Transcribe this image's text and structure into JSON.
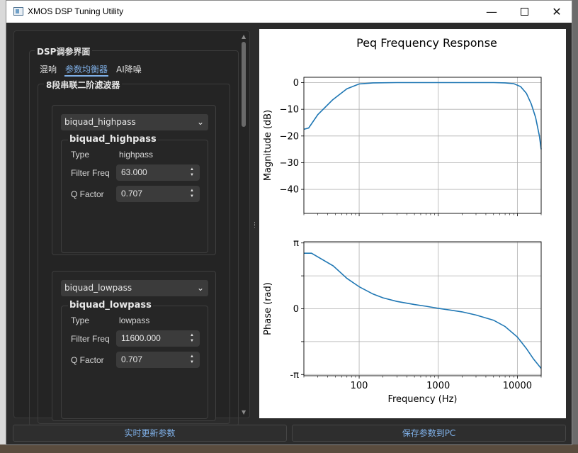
{
  "window": {
    "title": "XMOS DSP Tuning Utility",
    "minimize": "—",
    "close": "✕"
  },
  "settings": {
    "group_title": "DSP调参界面",
    "tabs": [
      {
        "label": "混响",
        "active": false
      },
      {
        "label": "参数均衡器",
        "active": true
      },
      {
        "label": "AI降噪",
        "active": false
      }
    ],
    "section_title": "8段串联二阶滤波器",
    "filters": [
      {
        "selected_type": "biquad_highpass",
        "group_title": "biquad_highpass",
        "type_label": "Type",
        "type_value": "highpass",
        "freq_label": "Filter Freq",
        "freq_value": "63.000",
        "q_label": "Q Factor",
        "q_value": "0.707"
      },
      {
        "selected_type": "biquad_lowpass",
        "group_title": "biquad_lowpass",
        "type_label": "Type",
        "type_value": "lowpass",
        "freq_label": "Filter Freq",
        "freq_value": "11600.000",
        "q_label": "Q Factor",
        "q_value": "0.707"
      }
    ]
  },
  "buttons": {
    "realtime": "实时更新参数",
    "save": "保存参数到PC"
  },
  "colors": {
    "accent": "#7fb0e8",
    "curve": "#1f77b4",
    "panel_bg": "#242424"
  },
  "icons": {
    "dropdown": "chevron-down-icon",
    "spin": "up-down-arrows-icon"
  },
  "chart_data": [
    {
      "type": "line",
      "title": "Peq Frequency Response",
      "xlabel": "",
      "ylabel": "Magnitude (dB)",
      "xscale": "log",
      "xlim": [
        20,
        20000
      ],
      "ylim": [
        -49,
        2
      ],
      "yticks": [
        0,
        -10,
        -20,
        -30,
        -40
      ],
      "ytick_labels": [
        "0",
        "−10",
        "−20",
        "−30",
        "−40"
      ],
      "grid": true,
      "series": [
        {
          "x": [
            20,
            23,
            30,
            46,
            70,
            100,
            150,
            300,
            1000,
            3000,
            5000,
            7000,
            9000,
            11000,
            13000,
            15000,
            17000,
            19000,
            20000
          ],
          "y": [
            -17.5,
            -17.0,
            -12.0,
            -6.5,
            -2.3,
            -0.5,
            -0.1,
            0,
            0,
            0,
            0,
            -0.1,
            -0.4,
            -1.5,
            -4,
            -8,
            -13,
            -20,
            -25
          ]
        }
      ]
    },
    {
      "type": "line",
      "title": "",
      "xlabel": "Frequency (Hz)",
      "ylabel": "Phase (rad)",
      "xscale": "log",
      "xlim": [
        20,
        20000
      ],
      "ylim": [
        -3.2,
        3.2
      ],
      "yticks": [
        3.14159,
        1.5708,
        0,
        -1.5708,
        -3.14159
      ],
      "ytick_labels": [
        "π",
        "",
        "0",
        "",
        "-π"
      ],
      "xticks": [
        100,
        1000,
        10000
      ],
      "xtick_labels": [
        "100",
        "1000",
        "10000"
      ],
      "grid": true,
      "series": [
        {
          "x": [
            20,
            25,
            47,
            70,
            100,
            150,
            200,
            300,
            500,
            700,
            1000,
            2000,
            3000,
            5000,
            7000,
            10000,
            13000,
            16000,
            20000
          ],
          "y": [
            2.65,
            2.65,
            2.05,
            1.45,
            1.05,
            0.7,
            0.52,
            0.35,
            0.2,
            0.12,
            0.02,
            -0.15,
            -0.3,
            -0.55,
            -0.85,
            -1.35,
            -1.9,
            -2.4,
            -2.85
          ]
        }
      ]
    }
  ]
}
